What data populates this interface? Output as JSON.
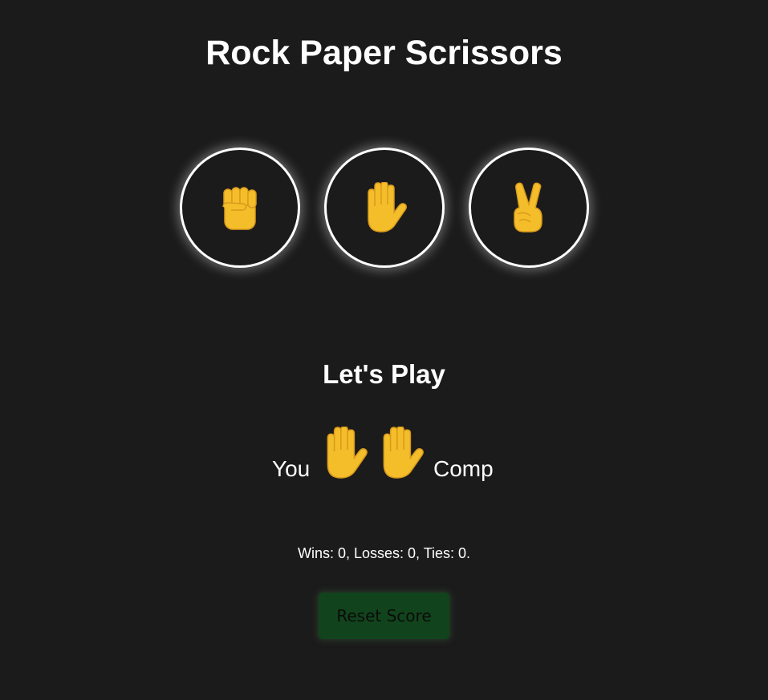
{
  "title": "Rock Paper Scrissors",
  "choices": [
    {
      "name": "rock",
      "icon": "raised-fist-icon"
    },
    {
      "name": "paper",
      "icon": "raised-hand-icon"
    },
    {
      "name": "scissors",
      "icon": "victory-hand-icon"
    }
  ],
  "result": {
    "heading": "Let's Play",
    "player_label": "You",
    "computer_label": "Comp",
    "player_move_icon": "raised-hand-icon",
    "computer_move_icon": "raised-hand-icon"
  },
  "score": {
    "text": "Wins: 0, Losses: 0, Ties: 0."
  },
  "reset_button": {
    "label": "Reset Score"
  },
  "colors": {
    "background": "#1b1b1b",
    "emoji_yellow": "#f4be2b",
    "button_green": "#11441c"
  }
}
